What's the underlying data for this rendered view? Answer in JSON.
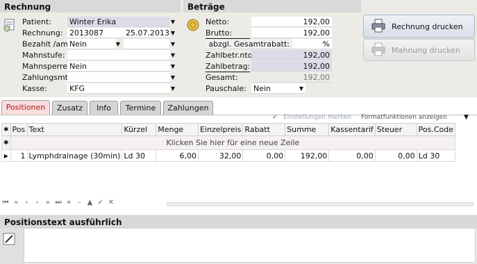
{
  "rechnung": {
    "title": "Rechnung",
    "patient_label": "Patient:",
    "patient_value": "Winter Erika",
    "rechnung_label": "Rechnung:",
    "rechnung_nr": "2013087",
    "rechnung_datum": "25.07.2013",
    "bezahlt_label": "Bezahlt /am:",
    "bezahlt_value": "Nein",
    "mahnstufe_label": "Mahnstufe:",
    "mahnsperre_label": "Mahnsperre:",
    "mahnsperre_value": "Nein",
    "zahlungsmtl_label": "Zahlungsmtl:",
    "kasse_label": "Kasse:",
    "kasse_value": "KFG"
  },
  "betraege": {
    "title": "Beträge",
    "netto_label": "Netto:",
    "netto_value": "192,00",
    "brutto_label": "Brutto:",
    "brutto_value": "192,00",
    "rabatt_label": "abzgl. Gesamtrabatt:",
    "rabatt_value": "%",
    "zahlbetr_nto_label": "Zahlbetr.nto.:",
    "zahlbetr_nto_value": "192,00",
    "zahlbetrag_label": "Zahlbetrag:",
    "zahlbetrag_value": "192,00",
    "gesamt_label": "Gesamt:",
    "gesamt_value": "192,00",
    "pauschale_label": "Pauschale:",
    "pauschale_value": "Nein"
  },
  "actions": {
    "rechnung_drucken": "Rechnung drucken",
    "mahnung_drucken": "Mahnung drucken"
  },
  "tabs": [
    "Positionen",
    "Zusatz",
    "Info",
    "Termine",
    "Zahlungen"
  ],
  "grid_toolbar": {
    "einstellungen": "Einstellungen merken",
    "formatfunktionen": "Formatfunktionen anzeigen"
  },
  "grid": {
    "columns": [
      "Pos",
      "Text",
      "Kürzel",
      "Menge",
      "Einzelpreis",
      "Rabatt",
      "Summe",
      "Kassentarif",
      "Steuer",
      "Pos.Code"
    ],
    "new_row_hint": "Klicken Sie hier für eine neue Zeile",
    "rows": [
      [
        "1",
        "Lymphdrainage (30min)",
        "Ld 30",
        "6,00",
        "32,00",
        "0,00",
        "192,00",
        "0,00",
        "0,00",
        "Ld 30"
      ]
    ]
  },
  "positionstext": {
    "title": "Positionstext ausführlich"
  }
}
